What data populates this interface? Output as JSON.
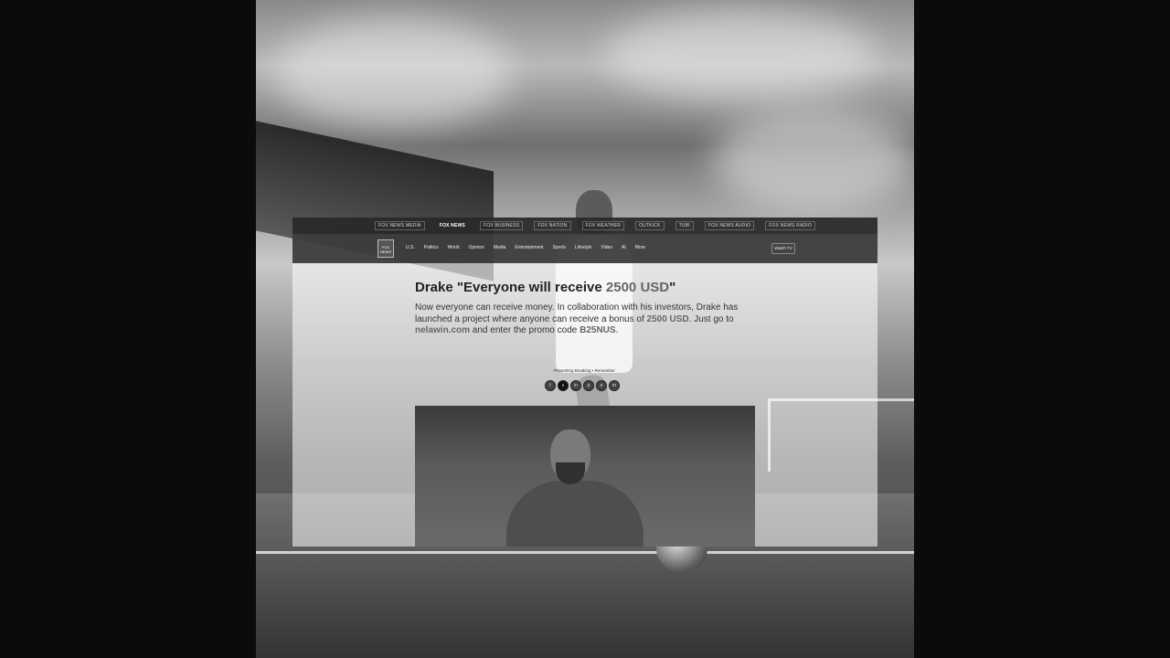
{
  "topbar": {
    "items": [
      "FOX NEWS MEDIA",
      "FOX NEWS",
      "FOX BUSINESS",
      "FOX NATION",
      "FOX WEATHER",
      "OUTKICK",
      "TUBI",
      "FOX NEWS AUDIO",
      "FOX NEWS RADIO"
    ]
  },
  "nav": {
    "logo_text": "FOX NEWS",
    "items": [
      "U.S.",
      "Politics",
      "World",
      "Opinion",
      "Media",
      "Entertainment",
      "Sports",
      "Lifestyle",
      "Video",
      "AI",
      "More"
    ],
    "watch_label": "Watch TV"
  },
  "article": {
    "headline_prefix": "Drake \"Everyone will receive ",
    "headline_amount": "2500 USD",
    "headline_suffix": "\"",
    "body_1": "Now everyone can receive money. In collaboration with his investors, Drake has launched a project where anyone can receive a bonus of ",
    "body_amount": "2500 USD",
    "body_2": ". Just go to ",
    "body_site": "nelawin.com",
    "body_3": " and enter the promo code ",
    "body_code": "B25NUS",
    "body_4": ".",
    "share_label": "Presenting Breaking • Remember",
    "share_icons": [
      "f",
      "x",
      "in",
      "p",
      "e",
      "m"
    ]
  }
}
